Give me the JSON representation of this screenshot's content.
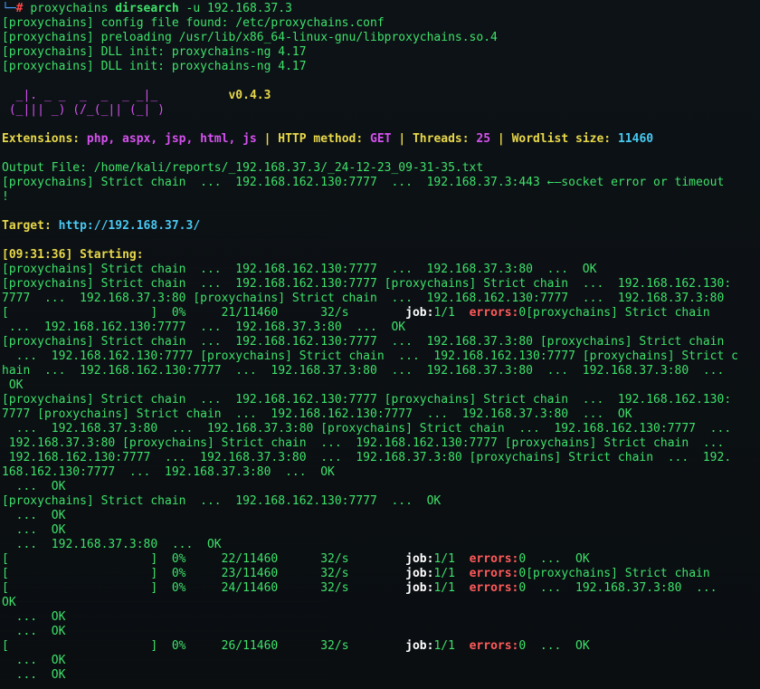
{
  "prompt": {
    "corner": "└─",
    "hash": "#",
    "command_prefix": "proxychains",
    "command_tool": "dirsearch",
    "command_args": "-u 192.168.37.3"
  },
  "init_lines": [
    "[proxychains] config file found: /etc/proxychains.conf",
    "[proxychains] preloading /usr/lib/x86_64-linux-gnu/libproxychains.so.4",
    "[proxychains] DLL init: proxychains-ng 4.17",
    "[proxychains] DLL init: proxychains-ng 4.17"
  ],
  "banner": {
    "art_line1": "  _|. _ _  _  _  _ _|_",
    "art_line2": " (_||| _) (/_(_|| (_| )",
    "version": "v0.4.3"
  },
  "config": {
    "ext_label": "Extensions:",
    "ext_value": "php, aspx, jsp, html, js",
    "sep": "|",
    "method_label": "HTTP method:",
    "method_value": "GET",
    "threads_label": "Threads:",
    "threads_value": "25",
    "wordlist_label": "Wordlist size:",
    "wordlist_value": "11460"
  },
  "output_file_line": "Output File: /home/kali/reports/_192.168.37.3/_24-12-23_09-31-35.txt",
  "socket_error_line": "[proxychains] Strict chain  ...  192.168.162.130:7777  ...  192.168.37.3:443 ←—socket error or timeout",
  "socket_error_tail": "!",
  "target": {
    "label": "Target:",
    "url": "http://192.168.37.3/"
  },
  "start": {
    "time": "[09:31:36]",
    "label": "Starting:"
  },
  "log_lines": [
    {
      "type": "plain",
      "text": "[proxychains] Strict chain  ...  192.168.162.130:7777  ...  192.168.37.3:80  ...  OK"
    },
    {
      "type": "plain",
      "text": "[proxychains] Strict chain  ...  192.168.162.130:7777 [proxychains] Strict chain  ...  192.168.162.130:"
    },
    {
      "type": "plain",
      "text": "7777  ...  192.168.37.3:80 [proxychains] Strict chain  ...  192.168.162.130:7777  ...  192.168.37.3:80"
    },
    {
      "type": "progress",
      "bar": "[                    ]",
      "pct": "0%",
      "count": "21/11460",
      "rate": "32/s",
      "job_label": "job:",
      "job_value": "1/1",
      "err_label": "errors:",
      "err_value": "0",
      "tail": "[proxychains] Strict chain"
    },
    {
      "type": "plain",
      "text": " ...  192.168.162.130:7777  ...  192.168.37.3:80  ...  OK"
    },
    {
      "type": "plain",
      "text": "[proxychains] Strict chain  ...  192.168.162.130:7777  ...  192.168.37.3:80 [proxychains] Strict chain"
    },
    {
      "type": "plain",
      "text": "  ...  192.168.162.130:7777 [proxychains] Strict chain  ...  192.168.162.130:7777 [proxychains] Strict c"
    },
    {
      "type": "plain",
      "text": "hain  ...  192.168.162.130:7777  ...  192.168.37.3:80  ...  192.168.37.3:80  ...  192.168.37.3:80  ..."
    },
    {
      "type": "plain",
      "text": " OK"
    },
    {
      "type": "plain",
      "text": "[proxychains] Strict chain  ...  192.168.162.130:7777 [proxychains] Strict chain  ...  192.168.162.130:"
    },
    {
      "type": "plain",
      "text": "7777 [proxychains] Strict chain  ...  192.168.162.130:7777  ...  192.168.37.3:80  ...  OK"
    },
    {
      "type": "plain",
      "text": "  ...  192.168.37.3:80  ...  192.168.37.3:80 [proxychains] Strict chain  ...  192.168.162.130:7777  ..."
    },
    {
      "type": "plain",
      "text": " 192.168.37.3:80 [proxychains] Strict chain  ...  192.168.162.130:7777 [proxychains] Strict chain  ..."
    },
    {
      "type": "plain",
      "text": " 192.168.162.130:7777  ...  192.168.37.3:80  ...  192.168.37.3:80 [proxychains] Strict chain  ...  192."
    },
    {
      "type": "plain",
      "text": "168.162.130:7777  ...  192.168.37.3:80  ...  OK"
    },
    {
      "type": "plain",
      "text": "  ...  OK"
    },
    {
      "type": "plain",
      "text": "[proxychains] Strict chain  ...  192.168.162.130:7777  ...  OK"
    },
    {
      "type": "plain",
      "text": "  ...  OK"
    },
    {
      "type": "plain",
      "text": "  ...  OK"
    },
    {
      "type": "plain",
      "text": "  ...  192.168.37.3:80  ...  OK"
    },
    {
      "type": "progress",
      "bar": "[                    ]",
      "pct": "0%",
      "count": "22/11460",
      "rate": "32/s",
      "job_label": "job:",
      "job_value": "1/1",
      "err_label": "errors:",
      "err_value": "0",
      "tail": "  ...  OK"
    },
    {
      "type": "progress",
      "bar": "[                    ]",
      "pct": "0%",
      "count": "23/11460",
      "rate": "32/s",
      "job_label": "job:",
      "job_value": "1/1",
      "err_label": "errors:",
      "err_value": "0",
      "tail": "[proxychains] Strict chain"
    },
    {
      "type": "progress",
      "bar": "[                    ]",
      "pct": "0%",
      "count": "24/11460",
      "rate": "32/s",
      "job_label": "job:",
      "job_value": "1/1",
      "err_label": "errors:",
      "err_value": "0",
      "tail": "  ...  192.168.37.3:80  ..."
    },
    {
      "type": "plain",
      "text": "OK"
    },
    {
      "type": "plain",
      "text": "  ...  OK"
    },
    {
      "type": "plain",
      "text": "  ...  OK"
    },
    {
      "type": "progress",
      "bar": "[                    ]",
      "pct": "0%",
      "count": "26/11460",
      "rate": "32/s",
      "job_label": "job:",
      "job_value": "1/1",
      "err_label": "errors:",
      "err_value": "0",
      "tail": "  ...  OK"
    },
    {
      "type": "plain",
      "text": "  ...  OK"
    },
    {
      "type": "plain",
      "text": "  ...  OK"
    }
  ],
  "colors": {
    "background": "#0b0f12",
    "text_green": "#3ee16a",
    "prompt_blue": "#4aa0ff",
    "hash_red": "#ff4848",
    "banner_magenta": "#d651f0",
    "label_yellow": "#e8d84a",
    "value_magenta": "#d651f0",
    "wordlist_cyan": "#49c9f2",
    "errors_red": "#ff5a5a"
  }
}
